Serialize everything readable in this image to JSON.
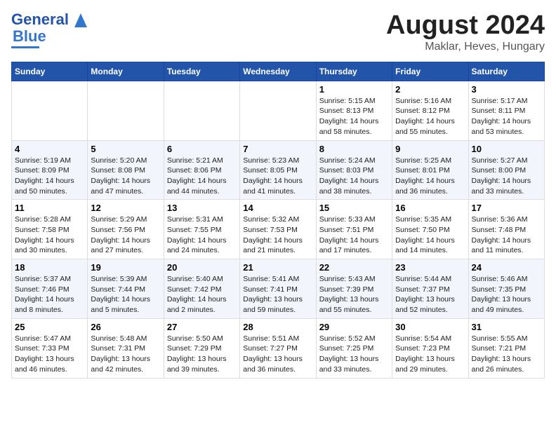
{
  "logo": {
    "line1": "General",
    "line2": "Blue"
  },
  "title": "August 2024",
  "subtitle": "Maklar, Heves, Hungary",
  "days_of_week": [
    "Sunday",
    "Monday",
    "Tuesday",
    "Wednesday",
    "Thursday",
    "Friday",
    "Saturday"
  ],
  "weeks": [
    [
      {
        "day": "",
        "info": ""
      },
      {
        "day": "",
        "info": ""
      },
      {
        "day": "",
        "info": ""
      },
      {
        "day": "",
        "info": ""
      },
      {
        "day": "1",
        "info": "Sunrise: 5:15 AM\nSunset: 8:13 PM\nDaylight: 14 hours\nand 58 minutes."
      },
      {
        "day": "2",
        "info": "Sunrise: 5:16 AM\nSunset: 8:12 PM\nDaylight: 14 hours\nand 55 minutes."
      },
      {
        "day": "3",
        "info": "Sunrise: 5:17 AM\nSunset: 8:11 PM\nDaylight: 14 hours\nand 53 minutes."
      }
    ],
    [
      {
        "day": "4",
        "info": "Sunrise: 5:19 AM\nSunset: 8:09 PM\nDaylight: 14 hours\nand 50 minutes."
      },
      {
        "day": "5",
        "info": "Sunrise: 5:20 AM\nSunset: 8:08 PM\nDaylight: 14 hours\nand 47 minutes."
      },
      {
        "day": "6",
        "info": "Sunrise: 5:21 AM\nSunset: 8:06 PM\nDaylight: 14 hours\nand 44 minutes."
      },
      {
        "day": "7",
        "info": "Sunrise: 5:23 AM\nSunset: 8:05 PM\nDaylight: 14 hours\nand 41 minutes."
      },
      {
        "day": "8",
        "info": "Sunrise: 5:24 AM\nSunset: 8:03 PM\nDaylight: 14 hours\nand 38 minutes."
      },
      {
        "day": "9",
        "info": "Sunrise: 5:25 AM\nSunset: 8:01 PM\nDaylight: 14 hours\nand 36 minutes."
      },
      {
        "day": "10",
        "info": "Sunrise: 5:27 AM\nSunset: 8:00 PM\nDaylight: 14 hours\nand 33 minutes."
      }
    ],
    [
      {
        "day": "11",
        "info": "Sunrise: 5:28 AM\nSunset: 7:58 PM\nDaylight: 14 hours\nand 30 minutes."
      },
      {
        "day": "12",
        "info": "Sunrise: 5:29 AM\nSunset: 7:56 PM\nDaylight: 14 hours\nand 27 minutes."
      },
      {
        "day": "13",
        "info": "Sunrise: 5:31 AM\nSunset: 7:55 PM\nDaylight: 14 hours\nand 24 minutes."
      },
      {
        "day": "14",
        "info": "Sunrise: 5:32 AM\nSunset: 7:53 PM\nDaylight: 14 hours\nand 21 minutes."
      },
      {
        "day": "15",
        "info": "Sunrise: 5:33 AM\nSunset: 7:51 PM\nDaylight: 14 hours\nand 17 minutes."
      },
      {
        "day": "16",
        "info": "Sunrise: 5:35 AM\nSunset: 7:50 PM\nDaylight: 14 hours\nand 14 minutes."
      },
      {
        "day": "17",
        "info": "Sunrise: 5:36 AM\nSunset: 7:48 PM\nDaylight: 14 hours\nand 11 minutes."
      }
    ],
    [
      {
        "day": "18",
        "info": "Sunrise: 5:37 AM\nSunset: 7:46 PM\nDaylight: 14 hours\nand 8 minutes."
      },
      {
        "day": "19",
        "info": "Sunrise: 5:39 AM\nSunset: 7:44 PM\nDaylight: 14 hours\nand 5 minutes."
      },
      {
        "day": "20",
        "info": "Sunrise: 5:40 AM\nSunset: 7:42 PM\nDaylight: 14 hours\nand 2 minutes."
      },
      {
        "day": "21",
        "info": "Sunrise: 5:41 AM\nSunset: 7:41 PM\nDaylight: 13 hours\nand 59 minutes."
      },
      {
        "day": "22",
        "info": "Sunrise: 5:43 AM\nSunset: 7:39 PM\nDaylight: 13 hours\nand 55 minutes."
      },
      {
        "day": "23",
        "info": "Sunrise: 5:44 AM\nSunset: 7:37 PM\nDaylight: 13 hours\nand 52 minutes."
      },
      {
        "day": "24",
        "info": "Sunrise: 5:46 AM\nSunset: 7:35 PM\nDaylight: 13 hours\nand 49 minutes."
      }
    ],
    [
      {
        "day": "25",
        "info": "Sunrise: 5:47 AM\nSunset: 7:33 PM\nDaylight: 13 hours\nand 46 minutes."
      },
      {
        "day": "26",
        "info": "Sunrise: 5:48 AM\nSunset: 7:31 PM\nDaylight: 13 hours\nand 42 minutes."
      },
      {
        "day": "27",
        "info": "Sunrise: 5:50 AM\nSunset: 7:29 PM\nDaylight: 13 hours\nand 39 minutes."
      },
      {
        "day": "28",
        "info": "Sunrise: 5:51 AM\nSunset: 7:27 PM\nDaylight: 13 hours\nand 36 minutes."
      },
      {
        "day": "29",
        "info": "Sunrise: 5:52 AM\nSunset: 7:25 PM\nDaylight: 13 hours\nand 33 minutes."
      },
      {
        "day": "30",
        "info": "Sunrise: 5:54 AM\nSunset: 7:23 PM\nDaylight: 13 hours\nand 29 minutes."
      },
      {
        "day": "31",
        "info": "Sunrise: 5:55 AM\nSunset: 7:21 PM\nDaylight: 13 hours\nand 26 minutes."
      }
    ]
  ]
}
